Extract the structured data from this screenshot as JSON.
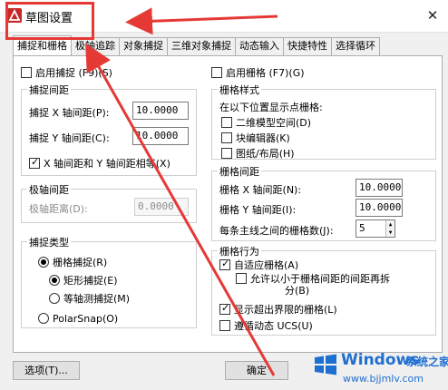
{
  "window": {
    "title": "草图设置",
    "close_symbol": "✕"
  },
  "tabs": [
    {
      "label": "捕捉和栅格",
      "active": true
    },
    {
      "label": "极轴追踪",
      "active": false
    },
    {
      "label": "对象捕捉",
      "active": false
    },
    {
      "label": "三维对象捕捉",
      "active": false
    },
    {
      "label": "动态输入",
      "active": false
    },
    {
      "label": "快捷特性",
      "active": false
    },
    {
      "label": "选择循环",
      "active": false
    }
  ],
  "snap": {
    "enable_label": "启用捕捉 (F9)(S)",
    "enabled": false,
    "spacing_title": "捕捉间距",
    "x_label": "捕捉 X 轴间距(P):",
    "x_value": "10.0000",
    "y_label": "捕捉 Y 轴间距(C):",
    "y_value": "10.0000",
    "equal_label": "X 轴间距和 Y 轴间距相等(X)",
    "equal_checked": true
  },
  "polar": {
    "title": "极轴间距",
    "distance_label": "极轴距离(D):",
    "distance_value": "0.0000"
  },
  "snap_type": {
    "title": "捕捉类型",
    "grid_snap_label": "栅格捕捉(R)",
    "rect_snap_label": "矩形捕捉(E)",
    "iso_snap_label": "等轴测捕捉(M)",
    "polar_snap_label": "PolarSnap(O)"
  },
  "grid": {
    "enable_label": "启用栅格 (F7)(G)",
    "enabled": false,
    "style_title": "栅格样式",
    "style_caption": "在以下位置显示点栅格:",
    "model_space_label": "二维模型空间(D)",
    "block_editor_label": "块编辑器(K)",
    "sheet_layout_label": "图纸/布局(H)",
    "spacing_title": "栅格间距",
    "x_label": "栅格 X 轴间距(N):",
    "x_value": "10.0000",
    "y_label": "栅格 Y 轴间距(I):",
    "y_value": "10.0000",
    "major_label": "每条主线之间的栅格数(J):",
    "major_value": "5",
    "behavior_title": "栅格行为",
    "adaptive_label": "自适应栅格(A)",
    "adaptive_checked": true,
    "subdivide_label_1": "允许以小于栅格间距的间距再拆",
    "subdivide_label_2": "分(B)",
    "beyond_limits_label": "显示超出界限的栅格(L)",
    "beyond_limits_checked": true,
    "follow_ucs_label": "遵循动态 UCS(U)",
    "follow_ucs_checked": false
  },
  "footer": {
    "options_label": "选项(T)...",
    "ok_label": "确定"
  },
  "watermark": {
    "brand": "Windows",
    "site_cn": "系统之家",
    "url": "www.bjjmlv.com"
  },
  "colors": {
    "annotation_red": "#e53935",
    "watermark_blue": "#1f6fd1"
  }
}
